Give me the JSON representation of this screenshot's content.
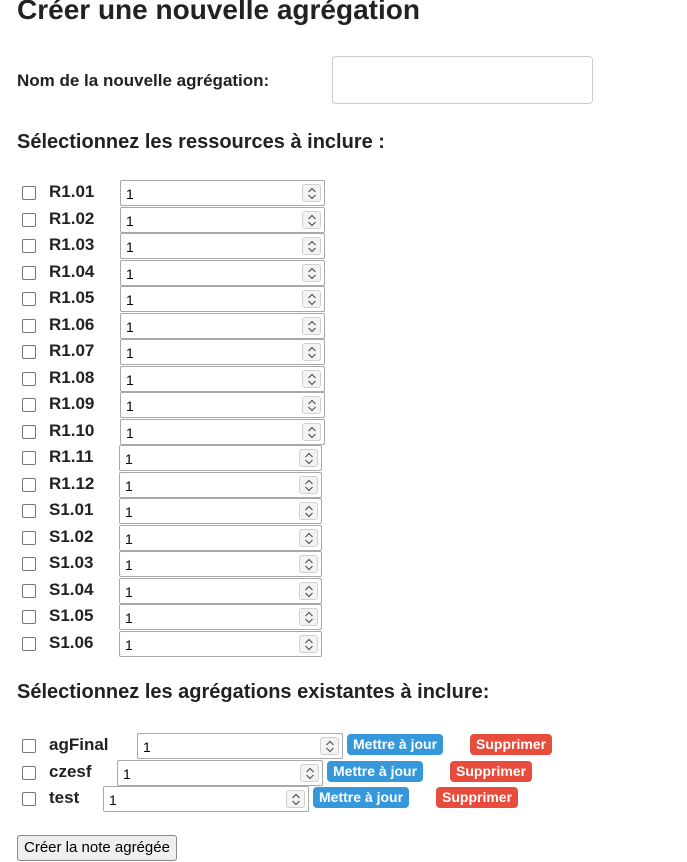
{
  "page": {
    "title": "Créer une nouvelle agrégation",
    "name_label": "Nom de la nouvelle agrégation:",
    "name_value": ""
  },
  "resources_section": {
    "heading": "Sélectionnez les ressources à inclure :",
    "items": [
      {
        "code": "R1.01",
        "coef": "1"
      },
      {
        "code": "R1.02",
        "coef": "1"
      },
      {
        "code": "R1.03",
        "coef": "1"
      },
      {
        "code": "R1.04",
        "coef": "1"
      },
      {
        "code": "R1.05",
        "coef": "1"
      },
      {
        "code": "R1.06",
        "coef": "1"
      },
      {
        "code": "R1.07",
        "coef": "1"
      },
      {
        "code": "R1.08",
        "coef": "1"
      },
      {
        "code": "R1.09",
        "coef": "1"
      },
      {
        "code": "R1.10",
        "coef": "1"
      },
      {
        "code": "R1.11",
        "coef": "1"
      },
      {
        "code": "R1.12",
        "coef": "1"
      },
      {
        "code": "S1.01",
        "coef": "1"
      },
      {
        "code": "S1.02",
        "coef": "1"
      },
      {
        "code": "S1.03",
        "coef": "1"
      },
      {
        "code": "S1.04",
        "coef": "1"
      },
      {
        "code": "S1.05",
        "coef": "1"
      },
      {
        "code": "S1.06",
        "coef": "1"
      }
    ]
  },
  "aggregations_section": {
    "heading": "Sélectionnez les agrégations existantes à inclure:",
    "update_label": "Mettre à jour",
    "delete_label": "Supprimer",
    "items": [
      {
        "name": "agFinal",
        "coef": "1"
      },
      {
        "name": "czesf",
        "coef": "1"
      },
      {
        "name": "test",
        "coef": "1"
      }
    ]
  },
  "submit_label": "Créer la note agrégée",
  "colors": {
    "update_button": "#3498db",
    "delete_button": "#e74c3c"
  }
}
